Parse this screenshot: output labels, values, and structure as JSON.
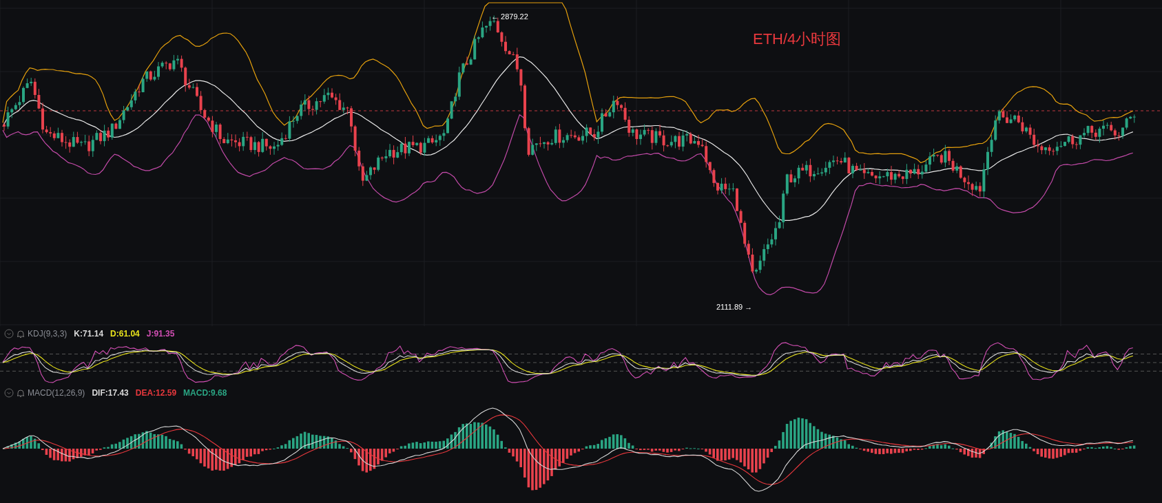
{
  "chart_title": "ETH/4小时图",
  "price_chart": {
    "high_label": "← 2879.22",
    "low_label": "2111.89 →"
  },
  "kdj": {
    "name": "KDJ(9,3,3)",
    "values": [
      {
        "text": "K:71.14",
        "color": "#d9d9d9"
      },
      {
        "text": "D:61.04",
        "color": "#e8e21c"
      },
      {
        "text": "J:91.35",
        "color": "#d24fb4"
      }
    ]
  },
  "macd": {
    "name": "MACD(12,26,9)",
    "values": [
      {
        "text": "DIF:17.43",
        "color": "#d9d9d9"
      },
      {
        "text": "DEA:12.59",
        "color": "#e8383d"
      },
      {
        "text": "MACD:9.68",
        "color": "#2aa583"
      }
    ]
  }
}
